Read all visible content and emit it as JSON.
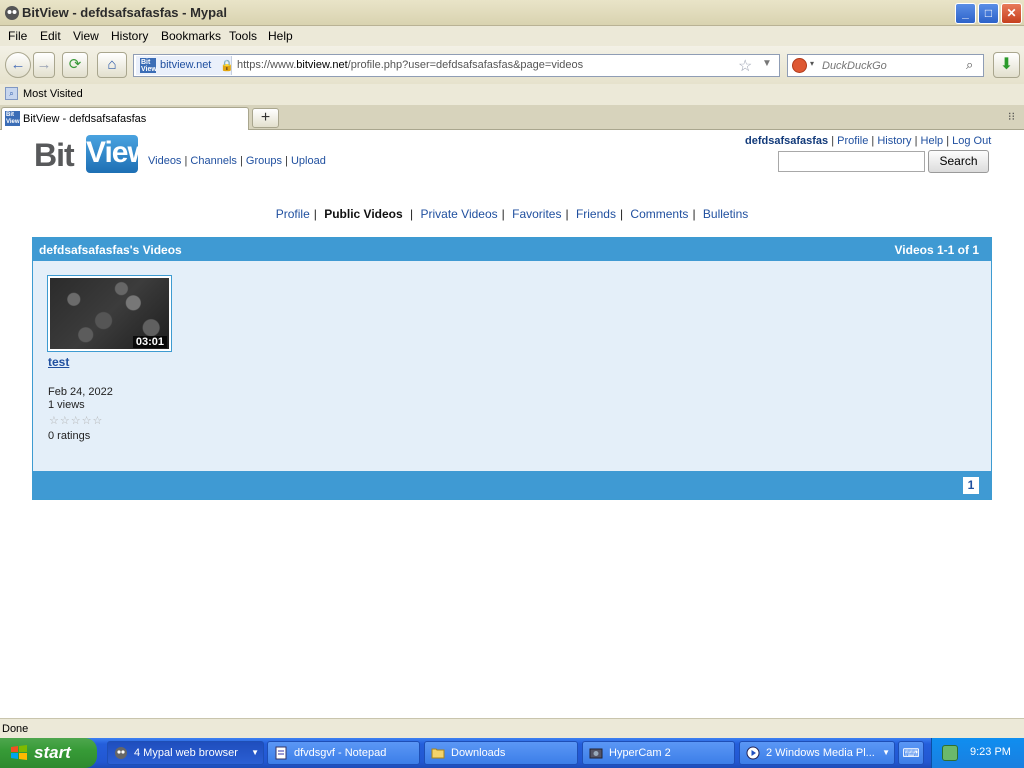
{
  "window": {
    "title": "BitView - defdsafsafasfas - Mypal",
    "minimize_label": "_",
    "maximize_label": "□",
    "close_label": "✕"
  },
  "menu": [
    "File",
    "Edit",
    "View",
    "History",
    "Bookmarks",
    "Tools",
    "Help"
  ],
  "toolbar": {
    "back_label": "←",
    "forward_label": "→",
    "reload_label": "⟳",
    "home_label": "⌂",
    "site_name": "bitview.net",
    "url_prefix": "https://www.",
    "url_domain": "bitview.net",
    "url_path": "/profile.php?user=defdsafsafasfas&page=videos",
    "star_label": "☆",
    "dropdown_label": "▼",
    "search_placeholder": "DuckDuckGo",
    "search_icon": "⌕",
    "download_label": "⬇",
    "engine_dropdown": "▾"
  },
  "bookmarks": {
    "items": [
      "Most Visited"
    ]
  },
  "tabs": {
    "items": [
      {
        "title": "BitView - defdsafsafasfas"
      }
    ],
    "new_tab_label": "+",
    "tab_list_label": "⁝⁝"
  },
  "site": {
    "logo_bit": "Bit",
    "logo_view": "View",
    "nav": [
      "Videos",
      "Channels",
      "Groups",
      "Upload"
    ],
    "username": "defdsafsafasfas",
    "user_links": [
      "Profile",
      "History",
      "Help",
      "Log Out"
    ],
    "search_button": "Search"
  },
  "profile_tabs": {
    "items": [
      "Profile",
      "Public Videos",
      "Private Videos",
      "Favorites",
      "Friends",
      "Comments",
      "Bulletins"
    ],
    "active": "Public Videos"
  },
  "videos": {
    "header_title": "defdsafsafasfas's Videos",
    "header_count": "Videos 1-1 of 1",
    "items": [
      {
        "title": "test",
        "duration": "03:01",
        "date": "Feb 24, 2022",
        "views": "1 views",
        "stars": "☆☆☆☆☆",
        "rating_value": 0,
        "ratings": "0 ratings"
      }
    ],
    "current_page": "1"
  },
  "statusbar": {
    "text": "Done"
  },
  "taskbar": {
    "start_label": "start",
    "buttons": [
      {
        "label": "4 Mypal web browser",
        "active": true
      },
      {
        "label": "dfvdsgvf - Notepad",
        "active": false
      },
      {
        "label": "Downloads",
        "active": false
      },
      {
        "label": "HyperCam 2",
        "active": false
      },
      {
        "label": "2 Windows Media Pl...",
        "active": false
      }
    ],
    "keyboard_icon": "⌨",
    "clock": "9:23 PM"
  },
  "colors": {
    "accent": "#3f9ad3",
    "link": "#1f4f9f",
    "panel_bg": "#e4eff9"
  }
}
